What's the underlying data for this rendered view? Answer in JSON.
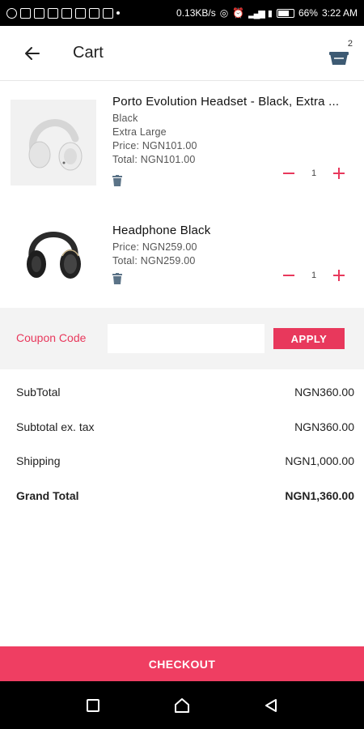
{
  "status_bar": {
    "net_speed": "0.13KB/s",
    "battery": "66%",
    "time": "3:22 AM"
  },
  "header": {
    "title": "Cart",
    "cart_count": "2"
  },
  "items": [
    {
      "title": "Porto Evolution Headset - Black, Extra ...",
      "color": "Black",
      "size": "Extra Large",
      "price": "Price: NGN101.00",
      "total": "Total: NGN101.00",
      "quantity": "1",
      "image": "white-headphones"
    },
    {
      "title": "Headphone Black",
      "price": "Price: NGN259.00",
      "total": "Total: NGN259.00",
      "quantity": "1",
      "image": "black-headphones"
    }
  ],
  "coupon": {
    "label": "Coupon Code",
    "value": "",
    "apply_label": "APPLY"
  },
  "totals": [
    {
      "label": "SubTotal",
      "value": "NGN360.00"
    },
    {
      "label": "Subtotal ex. tax",
      "value": "NGN360.00"
    },
    {
      "label": "Shipping",
      "value": "NGN1,000.00"
    },
    {
      "label": "Grand Total",
      "value": "NGN1,360.00"
    }
  ],
  "checkout_label": "CHECKOUT",
  "colors": {
    "accent": "#e8385c",
    "checkout": "#ef3e62"
  }
}
